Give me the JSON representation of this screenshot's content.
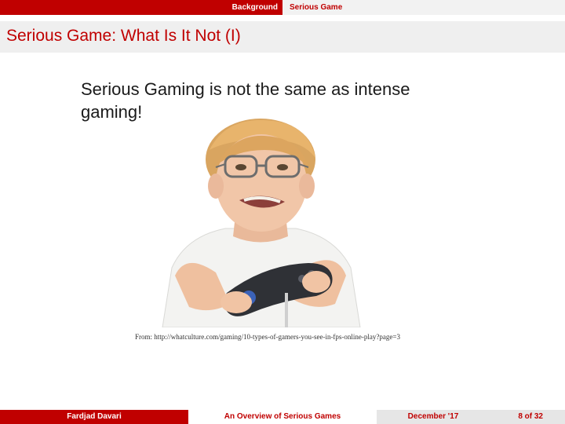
{
  "nav": {
    "section": "Background",
    "subsection": "Serious Game"
  },
  "slide": {
    "title": "Serious Game: What Is It Not (I)",
    "statement": "Serious Gaming is not the same as intense gaming!",
    "image": {
      "description_icon": "boy-with-game-controller-photo"
    },
    "caption": "From: http://whatculture.com/gaming/10-types-of-gamers-you-see-in-fps-online-play?page=3"
  },
  "footer": {
    "author": "Fardjad Davari",
    "talk_title": "An Overview of Serious Games",
    "date": "December '17",
    "page": "8 of 32"
  },
  "colors": {
    "accent": "#c00000",
    "title_bar": "#efefef",
    "footer_gray": "#e6e6e6"
  }
}
